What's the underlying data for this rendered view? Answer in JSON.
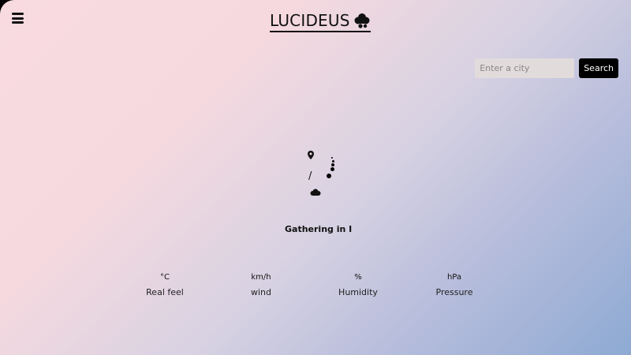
{
  "header": {
    "brand": "LUCIDEUS",
    "brand_icon": "cloud-logo-icon",
    "menu_icon": "hamburger-icon"
  },
  "search": {
    "placeholder": "Enter a city",
    "button_label": "Search"
  },
  "weather": {
    "location_icon": "map-pin-icon",
    "separator": "/",
    "condition_icon": "cloud-icon",
    "loading_text": "Gathering in I"
  },
  "stats": [
    {
      "unit": "°C",
      "label": "Real feel"
    },
    {
      "unit": "km/h",
      "label": "wind"
    },
    {
      "unit": "%",
      "label": "Humidity"
    },
    {
      "unit": "hPa",
      "label": "Pressure"
    }
  ],
  "colors": {
    "gradient_start": "#f8dbe0",
    "gradient_end": "#8eaad3",
    "button_bg": "#000000"
  }
}
